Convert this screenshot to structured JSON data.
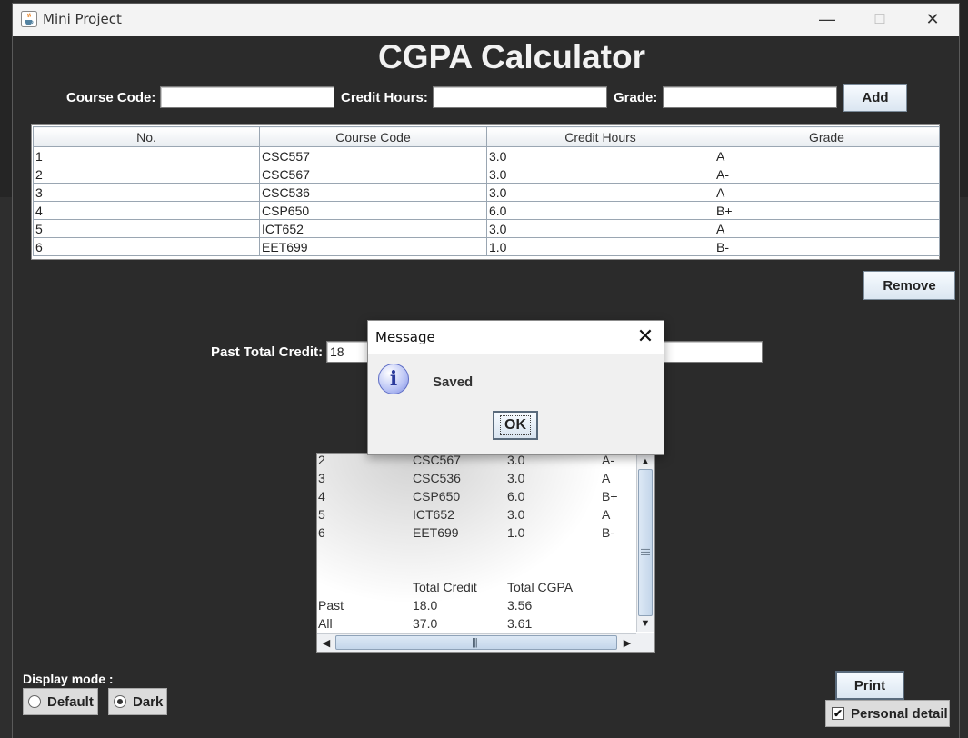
{
  "window": {
    "title": "Mini Project",
    "minimize_glyph": "—",
    "maximize_glyph": "☐",
    "close_glyph": "✕",
    "app_icon": "java-coffee-icon"
  },
  "header": {
    "title": "CGPA Calculator"
  },
  "form": {
    "course_code_label": "Course Code:",
    "course_code_value": "",
    "credit_hours_label": "Credit Hours:",
    "credit_hours_value": "",
    "grade_label": "Grade:",
    "grade_value": "",
    "add_label": "Add"
  },
  "table": {
    "columns": [
      "No.",
      "Course Code",
      "Credit Hours",
      "Grade"
    ],
    "rows": [
      [
        "1",
        "CSC557",
        "3.0",
        "A"
      ],
      [
        "2",
        "CSC567",
        "3.0",
        "A-"
      ],
      [
        "3",
        "CSC536",
        "3.0",
        "A"
      ],
      [
        "4",
        "CSP650",
        "6.0",
        "B+"
      ],
      [
        "5",
        "ICT652",
        "3.0",
        "A"
      ],
      [
        "6",
        "EET699",
        "1.0",
        "B-"
      ]
    ]
  },
  "remove_label": "Remove",
  "past_total_credit": {
    "label": "Past Total Credit:",
    "value": "18"
  },
  "summary": {
    "course_rows": [
      [
        "2",
        "CSC567",
        "3.0",
        "A-"
      ],
      [
        "3",
        "CSC536",
        "3.0",
        "A"
      ],
      [
        "4",
        "CSP650",
        "6.0",
        "B+"
      ],
      [
        "5",
        "ICT652",
        "3.0",
        "A"
      ],
      [
        "6",
        "EET699",
        "1.0",
        "B-"
      ]
    ],
    "totals_header": [
      "",
      "Total Credit",
      "Total CGPA"
    ],
    "totals_rows": [
      [
        "Past",
        "18.0",
        "3.56"
      ],
      [
        "All",
        "37.0",
        "3.61"
      ]
    ]
  },
  "dialog": {
    "title": "Message",
    "message": "Saved",
    "ok_label": "OK",
    "info_glyph": "i",
    "close_glyph": "✕"
  },
  "display_mode": {
    "label": "Display mode :",
    "default_label": "Default",
    "dark_label": "Dark",
    "selected": "Dark"
  },
  "print_label": "Print",
  "personal_detail": {
    "label": "Personal detail",
    "checked": true,
    "check_glyph": "✔"
  }
}
